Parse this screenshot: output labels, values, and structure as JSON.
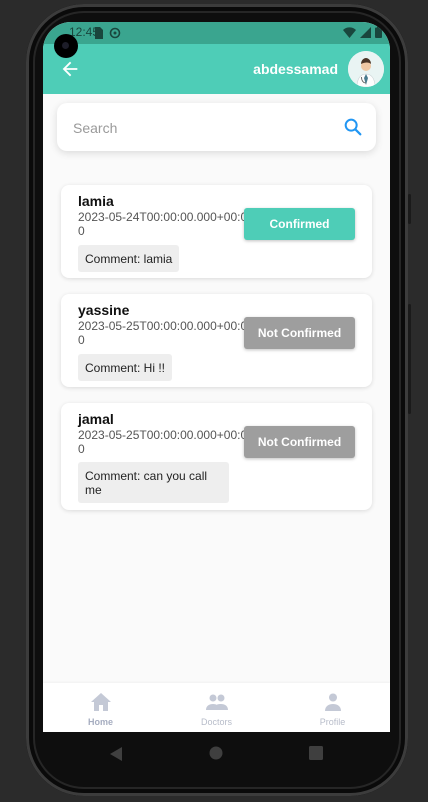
{
  "status_bar": {
    "time": "12:45"
  },
  "app_bar": {
    "username": "abdessamad"
  },
  "search": {
    "placeholder": "Search"
  },
  "appointments": [
    {
      "name": "lamia",
      "date": "2023-05-24T00:00:00.000+00:00",
      "comment": "Comment: lamia",
      "status": "Confirmed",
      "status_color": "#4ecdb7"
    },
    {
      "name": "yassine",
      "date": "2023-05-25T00:00:00.000+00:00",
      "comment": "Comment: Hi !!",
      "status": "Not Confirmed",
      "status_color": "#9e9e9e"
    },
    {
      "name": "jamal",
      "date": "2023-05-25T00:00:00.000+00:00",
      "comment": "Comment: can you call me",
      "status": "Not Confirmed",
      "status_color": "#9e9e9e"
    }
  ],
  "bottom_nav": {
    "items": [
      {
        "label": "Home",
        "icon": "home-icon"
      },
      {
        "label": "Doctors",
        "icon": "people-icon"
      },
      {
        "label": "Profile",
        "icon": "person-icon"
      }
    ]
  },
  "colors": {
    "accent": "#4ecdb7",
    "confirmed": "#4ecdb7",
    "not_confirmed": "#9e9e9e"
  }
}
